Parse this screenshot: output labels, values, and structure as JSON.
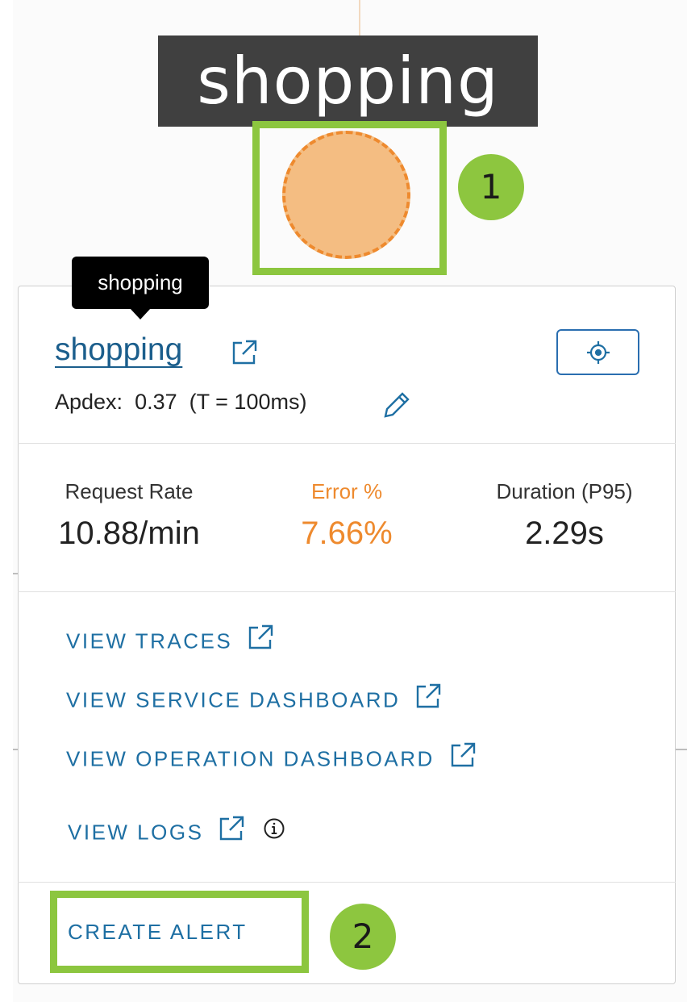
{
  "node": {
    "title": "shopping"
  },
  "callouts": {
    "one": "1",
    "two": "2"
  },
  "tooltip": {
    "text": "shopping"
  },
  "service": {
    "name": "shopping",
    "apdex_label": "Apdex:",
    "apdex_value": "0.37",
    "apdex_threshold": "(T = 100ms)"
  },
  "metrics": {
    "request_rate": {
      "label": "Request Rate",
      "value": "10.88/min"
    },
    "error": {
      "label": "Error %",
      "value": "7.66%"
    },
    "duration": {
      "label": "Duration (P95)",
      "value": "2.29s"
    }
  },
  "actions": {
    "view_traces": "VIEW TRACES",
    "view_service_dashboard": "VIEW SERVICE DASHBOARD",
    "view_operation_dashboard": "VIEW OPERATION DASHBOARD",
    "view_logs": "VIEW LOGS",
    "create_alert": "CREATE ALERT"
  },
  "icons": {
    "external_link": "external-link-icon",
    "locate": "locate-icon",
    "edit": "pencil-icon",
    "info": "info-icon"
  },
  "colors": {
    "highlight": "#8cc63f",
    "callout": "#8dc63f",
    "node_fill": "#f4bd82",
    "node_border": "#ee8a2e",
    "error": "#ee8a2e",
    "link": "#1e6fa3"
  }
}
